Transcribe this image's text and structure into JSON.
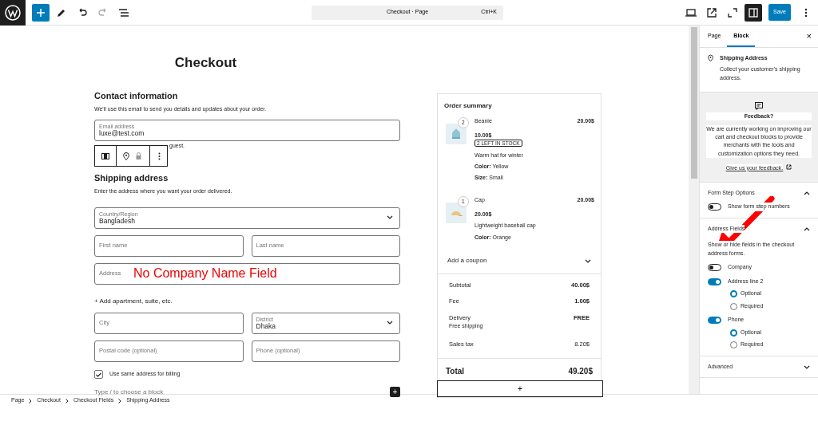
{
  "topbar": {
    "title": "Checkout · Page",
    "shortcut": "Ctrl+K",
    "save": "Save"
  },
  "page_title": "Checkout",
  "contact": {
    "heading": "Contact information",
    "description": "We'll use this email to send you details and updates about your order.",
    "email": {
      "label": "Email address",
      "value": "luxe@test.com"
    },
    "note": "guest."
  },
  "shipping": {
    "heading": "Shipping address",
    "description": "Enter the address where you want your order delivered.",
    "rows": [
      [
        {
          "kind": "select",
          "label": "Country/Region",
          "value": "Bangladesh"
        }
      ],
      [
        {
          "kind": "input",
          "placeholder": "First name"
        },
        {
          "kind": "input",
          "placeholder": "Last name"
        }
      ],
      [
        {
          "kind": "input",
          "placeholder": "Address",
          "annotation": "No Company Name Field"
        }
      ],
      [
        {
          "kind": "link",
          "text": "+ Add apartment, suite, etc."
        }
      ],
      [
        {
          "kind": "input",
          "placeholder": "City"
        },
        {
          "kind": "select",
          "label": "District",
          "value": "Dhaka"
        }
      ],
      [
        {
          "kind": "input",
          "placeholder": "Postal code (optional)"
        },
        {
          "kind": "input",
          "placeholder": "Phone (optional)"
        }
      ],
      [
        {
          "kind": "checkbox",
          "label": "Use same address for billing",
          "checked": true
        }
      ]
    ],
    "inserter": {
      "placeholder": "Type / to choose a block",
      "button": "+"
    }
  },
  "order_summary": {
    "title": "Order summary",
    "items": [
      {
        "quantity": "2",
        "name": "Beanie",
        "total": "20.00$",
        "price": "10.00$",
        "badge": "2 LEFT IN STOCK",
        "description": "Warm hat for winter",
        "attributes": [
          {
            "name": "Color:",
            "value": "Yellow"
          },
          {
            "name": "Size:",
            "value": "Small"
          }
        ]
      },
      {
        "quantity": "1",
        "name": "Cap",
        "total": "20.00$",
        "price": "20.00$",
        "description": "Lightweight baseball cap",
        "attributes": [
          {
            "name": "Color:",
            "value": "Orange"
          }
        ]
      }
    ],
    "coupon": "Add a coupon",
    "totals": [
      {
        "label": "Subtotal",
        "value": "40.00$"
      },
      {
        "label": "Fee",
        "value": "1.00$"
      },
      {
        "label": "Delivery",
        "value": "FREE",
        "note": "Free shipping"
      },
      {
        "label": "Sales tax",
        "value": "8.20$"
      }
    ],
    "total": {
      "label": "Total",
      "value": "49.20$"
    },
    "add_button": "+"
  },
  "sidebar": {
    "tabs": [
      {
        "label": "Page",
        "selected": false
      },
      {
        "label": "Block",
        "selected": true
      }
    ],
    "close": "×",
    "block": {
      "title": "Shipping Address",
      "description": "Collect your customer's shipping address."
    },
    "feedback": {
      "title": "Feedback?",
      "text": "We are currently working on improving our cart and checkout blocks to provide merchants with the tools and customization options they need.",
      "link": "Give us your feedback."
    },
    "panels": [
      {
        "title": "Form Step Options",
        "expanded": true,
        "controls": [
          {
            "label": "Show form step numbers",
            "on": false
          }
        ]
      },
      {
        "title": "Address Fields",
        "expanded": true,
        "description": "Show or hide fields in the checkout address forms.",
        "controls": [
          {
            "label": "Company",
            "on": false
          },
          {
            "label": "Address line 2",
            "on": true,
            "options": [
              {
                "label": "Optional",
                "selected": true
              },
              {
                "label": "Required",
                "selected": false
              }
            ]
          },
          {
            "label": "Phone",
            "on": true,
            "options": [
              {
                "label": "Optional",
                "selected": true
              },
              {
                "label": "Required",
                "selected": false
              }
            ]
          }
        ]
      },
      {
        "title": "Advanced",
        "expanded": false
      }
    ]
  },
  "breadcrumb": [
    "Page",
    "Checkout",
    "Checkout Fields",
    "Shipping Address"
  ]
}
